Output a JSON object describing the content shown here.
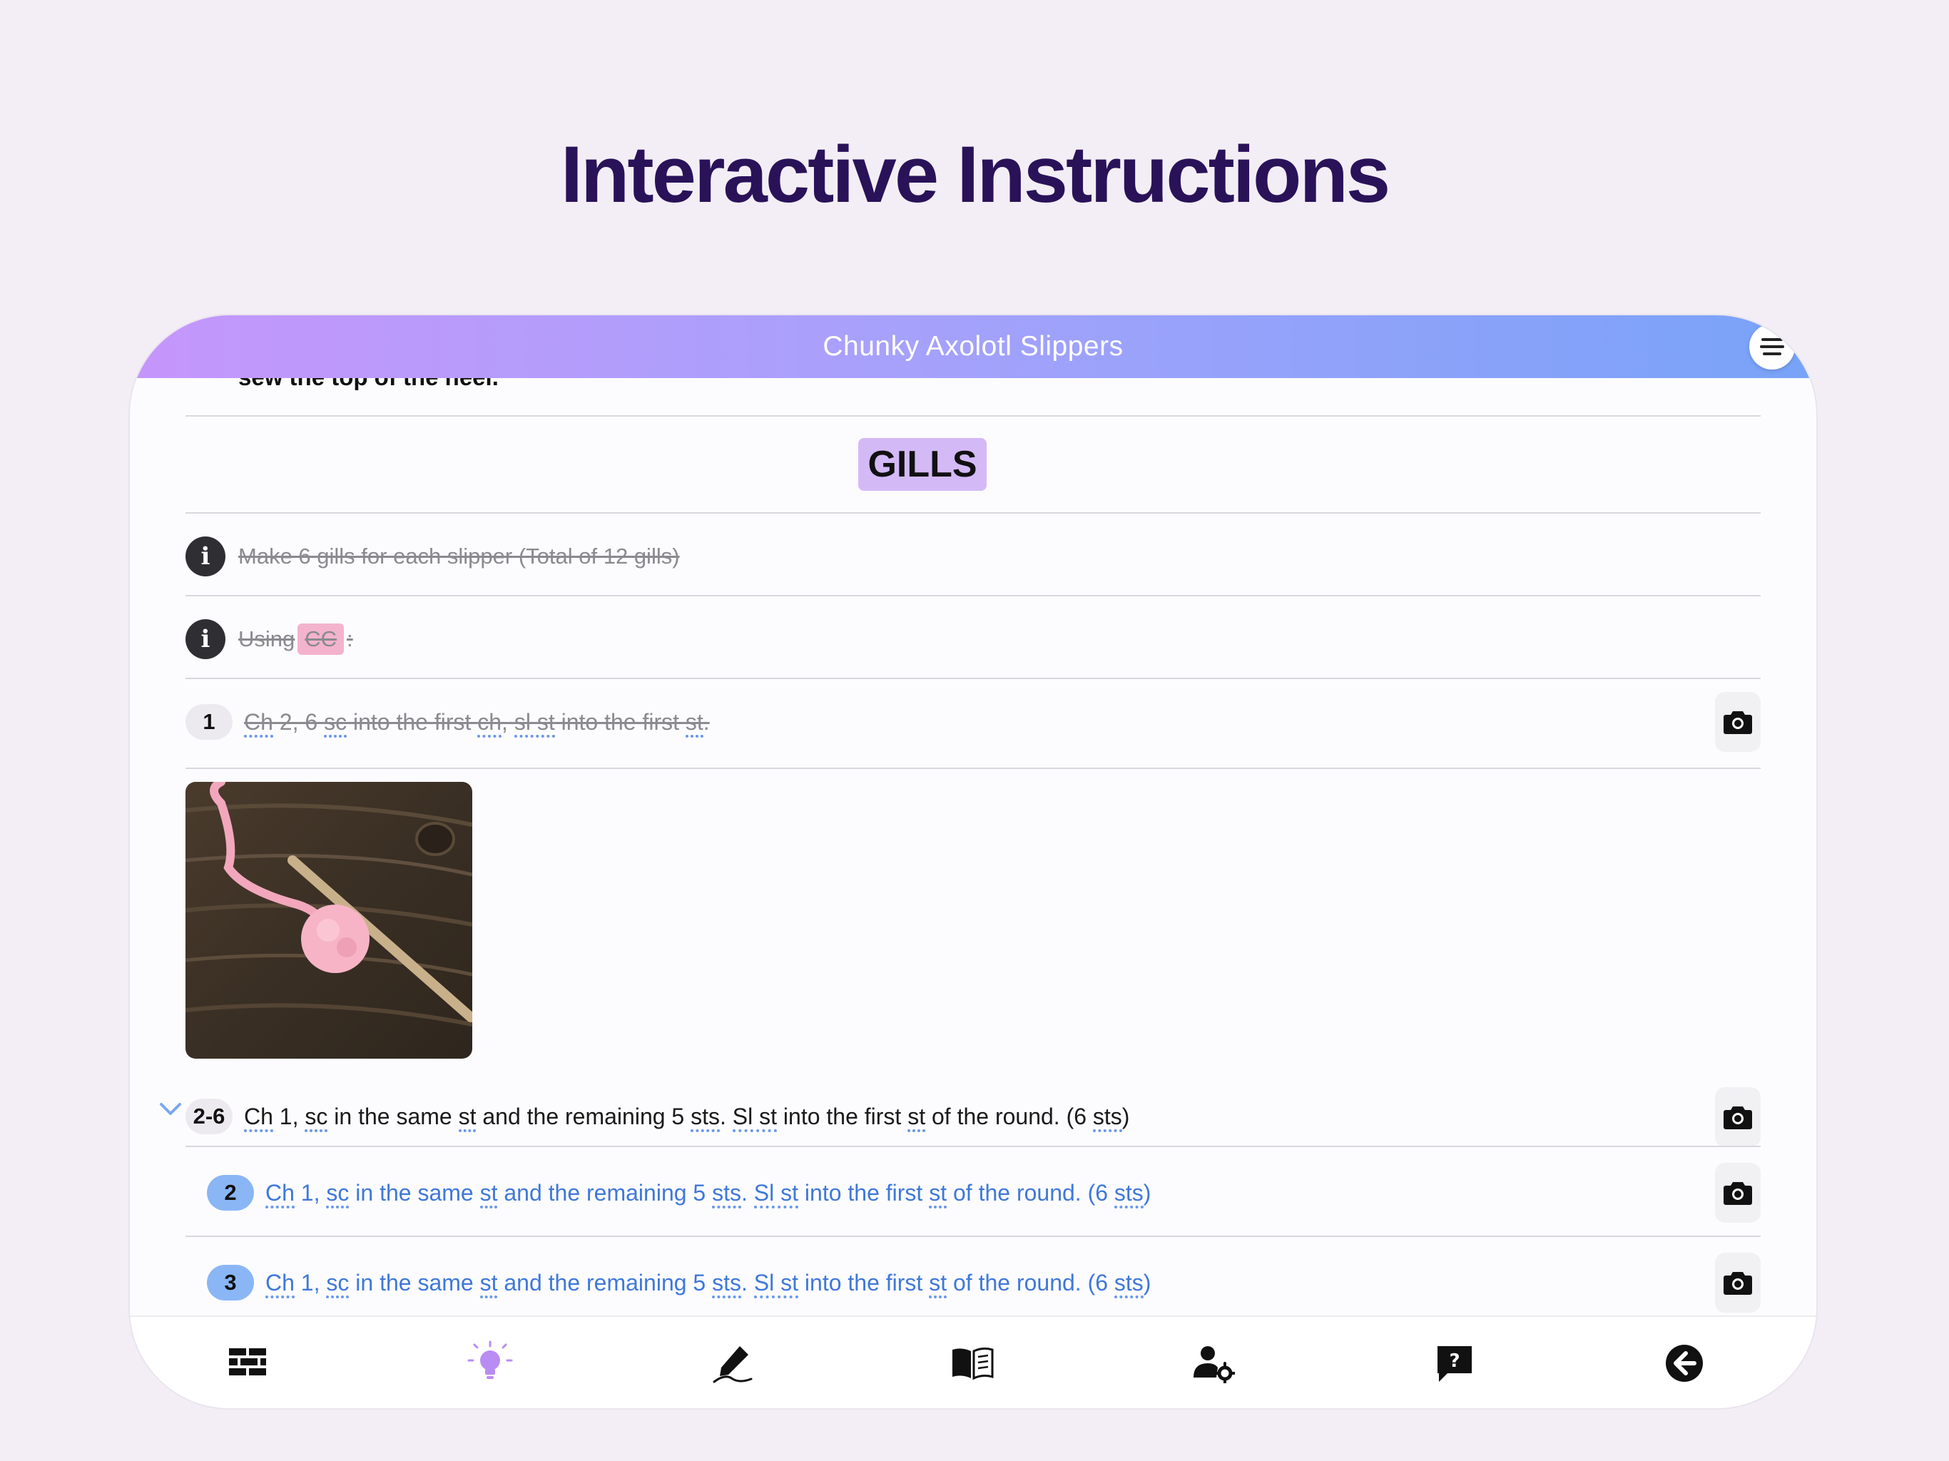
{
  "hero": {
    "title": "Interactive Instructions"
  },
  "app": {
    "title": "Chunky Axolotl Slippers"
  },
  "peek_text": "sew the top of the heel.",
  "section": {
    "label": "GILLS"
  },
  "info_rows": [
    {
      "text": "Make 6 gills for each slipper (Total of 12 gills)"
    },
    {
      "prefix": "Using ",
      "chip": "CC",
      "suffix": ":"
    }
  ],
  "steps": [
    {
      "number": "1",
      "parts": [
        "Ch",
        " 2, 6 ",
        "sc",
        " into the first ",
        "ch",
        ", ",
        "sl st",
        " into the first ",
        "st",
        "."
      ]
    },
    {
      "number": "2-6",
      "parts": [
        "Ch",
        " 1, ",
        "sc",
        " in the same ",
        "st",
        " and the remaining 5 ",
        "sts",
        ". ",
        "Sl st",
        " into the first ",
        "st",
        " of the round. (6 ",
        "sts",
        ")"
      ]
    },
    {
      "number": "2",
      "parts": [
        "Ch",
        " 1, ",
        "sc",
        " in the same ",
        "st",
        " and the remaining 5 ",
        "sts",
        ". ",
        "Sl st",
        " into the first ",
        "st",
        " of the round. (6 ",
        "sts",
        ")"
      ]
    },
    {
      "number": "3",
      "parts": [
        "Ch",
        " 1, ",
        "sc",
        " in the same ",
        "st",
        " and the remaining 5 ",
        "sts",
        ". ",
        "Sl st",
        " into the first ",
        "st",
        " of the round. (6 ",
        "sts",
        ")"
      ]
    }
  ],
  "nav": [
    "bricks-icon",
    "lightbulb-icon",
    "pen-icon",
    "book-icon",
    "user-settings-icon",
    "help-icon",
    "back-icon"
  ],
  "colors": {
    "accent_purple": "#c596fb",
    "accent_blue": "#78a3f8",
    "link_blue": "#3f78d9",
    "section_chip": "#d4b9f7",
    "cc_chip": "#f4b3cc"
  }
}
